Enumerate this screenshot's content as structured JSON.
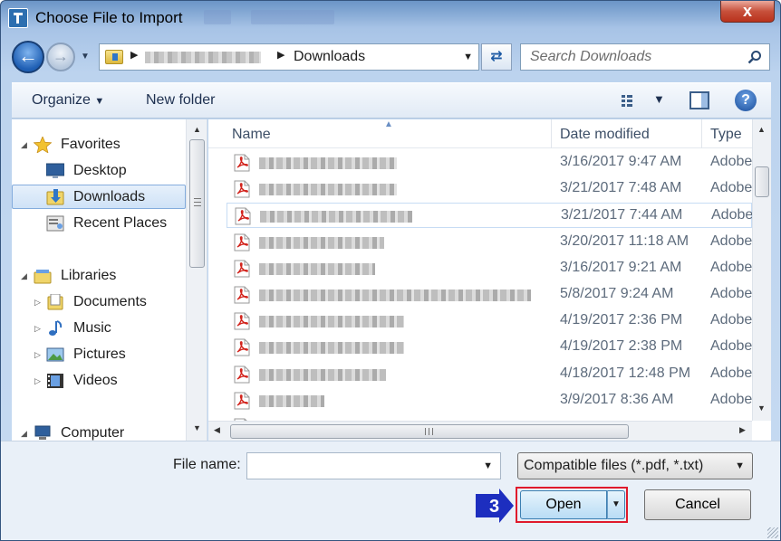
{
  "window": {
    "title": "Choose File to Import",
    "close_label": "x"
  },
  "address": {
    "crumb_blurred": "",
    "current": "Downloads"
  },
  "search": {
    "placeholder": "Search Downloads"
  },
  "toolbar": {
    "organize": "Organize",
    "new_folder": "New folder",
    "help": "?"
  },
  "nav": {
    "favorites": "Favorites",
    "desktop": "Desktop",
    "downloads": "Downloads",
    "recent": "Recent Places",
    "libraries": "Libraries",
    "documents": "Documents",
    "music": "Music",
    "pictures": "Pictures",
    "videos": "Videos",
    "computer": "Computer",
    "selected": "Downloads"
  },
  "columns": {
    "name": "Name",
    "date": "Date modified",
    "type": "Type"
  },
  "files": [
    {
      "name": "",
      "date": "3/16/2017 9:47 AM",
      "type": "Adobe"
    },
    {
      "name": "",
      "date": "3/21/2017 7:48 AM",
      "type": "Adobe"
    },
    {
      "name": "",
      "date": "3/21/2017 7:44 AM",
      "type": "Adobe"
    },
    {
      "name": "",
      "date": "3/20/2017 11:18 AM",
      "type": "Adobe"
    },
    {
      "name": "",
      "date": "3/16/2017 9:21 AM",
      "type": "Adobe"
    },
    {
      "name": "",
      "date": "5/8/2017 9:24 AM",
      "type": "Adobe"
    },
    {
      "name": "",
      "date": "4/19/2017 2:36 PM",
      "type": "Adobe"
    },
    {
      "name": "",
      "date": "4/19/2017 2:38 PM",
      "type": "Adobe"
    },
    {
      "name": "",
      "date": "4/18/2017 12:48 PM",
      "type": "Adobe"
    },
    {
      "name": "",
      "date": "3/9/2017 8:36 AM",
      "type": "Adobe"
    }
  ],
  "bottom": {
    "file_name_label": "File name:",
    "file_name_value": "",
    "file_type": "Compatible files (*.pdf, *.txt)",
    "open": "Open",
    "cancel": "Cancel",
    "step": "3"
  },
  "colors": {
    "accent": "#1f5fb4",
    "highlight_outline": "#e01a2c",
    "step_badge": "#1d2ebf"
  }
}
